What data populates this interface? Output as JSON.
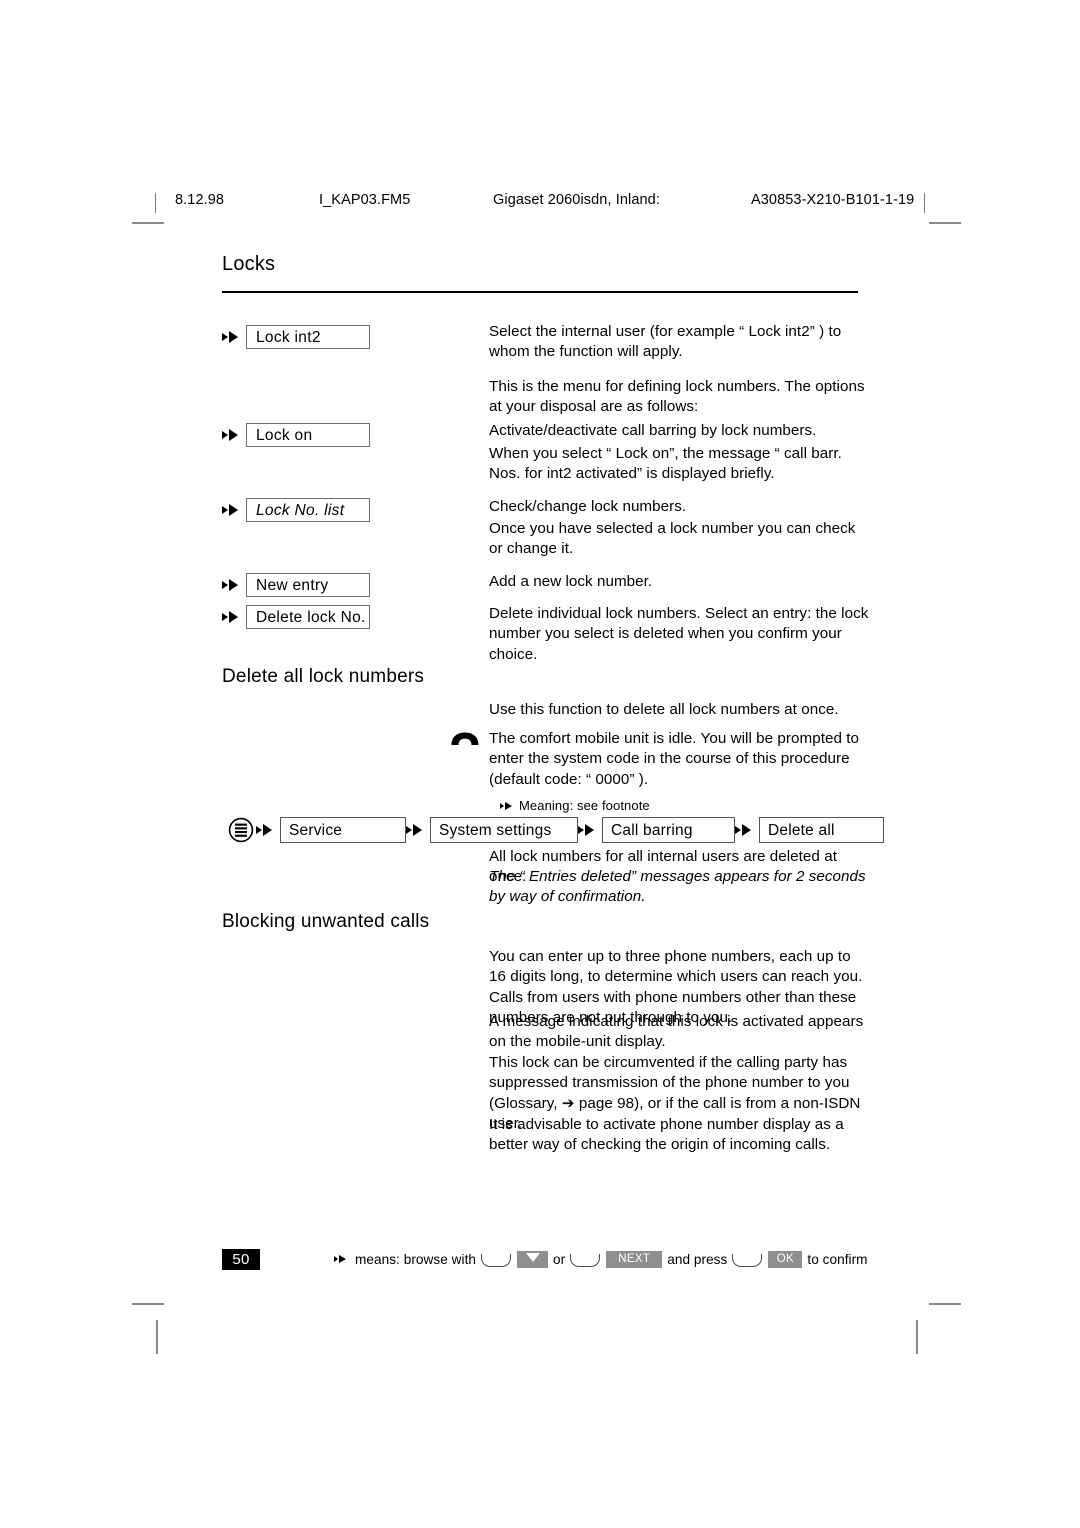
{
  "header": {
    "date": "8.12.98",
    "file": "I_KAP03.FM5",
    "product": "Gigaset 2060isdn, Inland:",
    "code": "A30853-X210-B101-1-19"
  },
  "chapter": {
    "title": "Locks"
  },
  "menu_items": [
    {
      "label": "Lock int2",
      "italic": false,
      "paragraphs": [
        "Select the internal user (for example “ Lock int2” ) to whom the function will apply.",
        "This is the menu for defining lock numbers. The options at your disposal are as follows:"
      ]
    },
    {
      "label": "Lock on",
      "italic": false,
      "paragraphs": [
        "Activate/deactivate call barring by lock numbers.",
        "When you select “ Lock on”, the message “ call barr. Nos. for int2 activated”  is displayed briefly."
      ]
    },
    {
      "label": "Lock No. list",
      "italic": true,
      "paragraphs": [
        "Check/change lock numbers.",
        "Once you have selected a lock number you can check or change it."
      ]
    },
    {
      "label": "New entry",
      "italic": false,
      "paragraphs": [
        "Add a new lock number."
      ]
    },
    {
      "label": "Delete lock No.",
      "italic": false,
      "paragraphs": [
        "Delete individual lock numbers. Select an entry: the lock number you select is deleted when you confirm your choice."
      ]
    }
  ],
  "delete_all_section": {
    "heading": "Delete all lock numbers",
    "intro": "Use this function to delete all lock numbers at once.",
    "idle_note": "The comfort mobile unit is idle. You will be prompted to enter the system code in the course of this procedure (default code: “ 0000” ).",
    "footnote_hint": "Meaning: see footnote",
    "menu_path": [
      "Service",
      "System settings",
      "Call barring",
      "Delete all"
    ],
    "result": "All lock numbers for all internal users are deleted at once.",
    "confirmation": "The “ Entries deleted”  messages appears for 2 seconds by way of confirmation."
  },
  "blocking_section": {
    "heading": "Blocking unwanted calls",
    "paragraphs": [
      "You can enter up to three phone numbers, each up to 16 digits long, to determine which users can reach you. Calls from users with phone numbers other than these numbers are not put through to you.",
      "A message indicating that this lock is activated appears on the mobile-unit display.",
      "This lock can be circumvented if the calling party has suppressed transmission of the phone number to you (Glossary, ➔ page 98), or if the call is from a non-ISDN user.",
      "It is advisable to activate phone number display as a better way of checking the origin of incoming calls."
    ]
  },
  "footer": {
    "page_number": "50",
    "text_means": "means: browse with",
    "text_or": "or",
    "text_and_press": "and press",
    "text_to_confirm": "to confirm",
    "key_next_label": "NEXT",
    "key_ok_label": "OK"
  },
  "colors": {
    "softkey_gray": "#8f8f8f",
    "rule_black": "#000000",
    "badge_black": "#000000"
  }
}
